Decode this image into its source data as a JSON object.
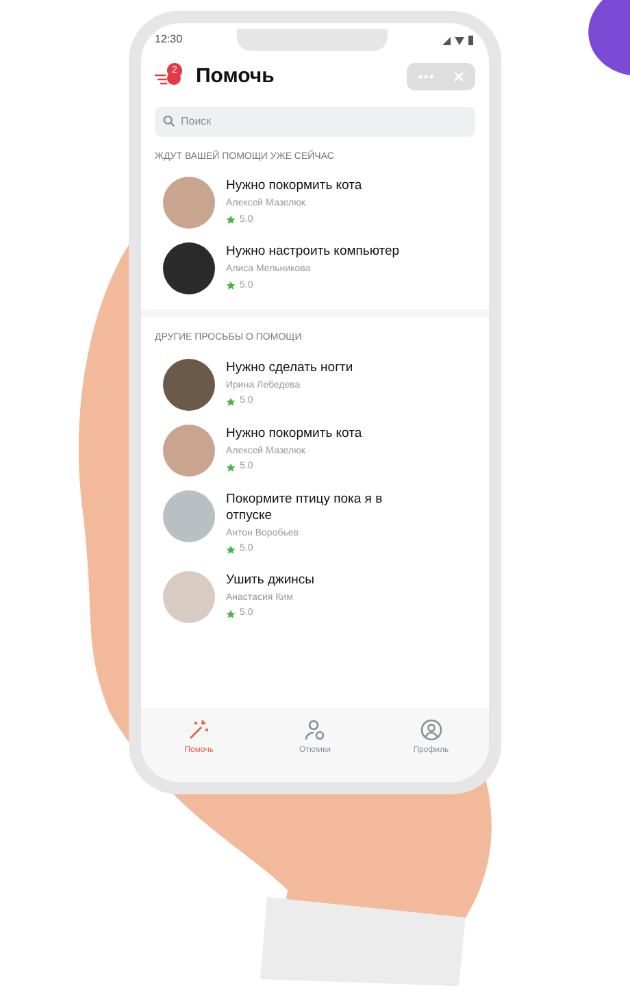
{
  "status_bar": {
    "time": "12:30"
  },
  "header": {
    "title": "Помочь",
    "badge": "2"
  },
  "search": {
    "placeholder": "Поиск"
  },
  "sections": [
    {
      "title": "ЖДУТ ВАШЕЙ ПОМОЩИ УЖЕ СЕЙЧАС",
      "items": [
        {
          "title": "Нужно покормить кота",
          "author": "Алексей Мазелюк",
          "rating": "5.0"
        },
        {
          "title": "Нужно настроить компьютер",
          "author": "Алиса Мельникова",
          "rating": "5.0"
        }
      ]
    },
    {
      "title": "ДРУГИЕ ПРОСЬБЫ О ПОМОЩИ",
      "items": [
        {
          "title": "Нужно сделать ногти",
          "author": "Ирина Лебедева",
          "rating": "5.0"
        },
        {
          "title": "Нужно покормить кота",
          "author": "Алексей Мазелюк",
          "rating": "5.0"
        },
        {
          "title": "Покормите птицу пока я в отпуске",
          "author": "Антон Воробьев",
          "rating": "5.0"
        },
        {
          "title": "Ушить джинсы",
          "author": "Анастасия Ким",
          "rating": "5.0"
        }
      ]
    }
  ],
  "tab_bar": [
    {
      "label": "Помочь",
      "kind": "wand",
      "selected": true
    },
    {
      "label": "Отклики",
      "kind": "people",
      "selected": false
    },
    {
      "label": "Профиль",
      "kind": "profile",
      "selected": false
    }
  ]
}
